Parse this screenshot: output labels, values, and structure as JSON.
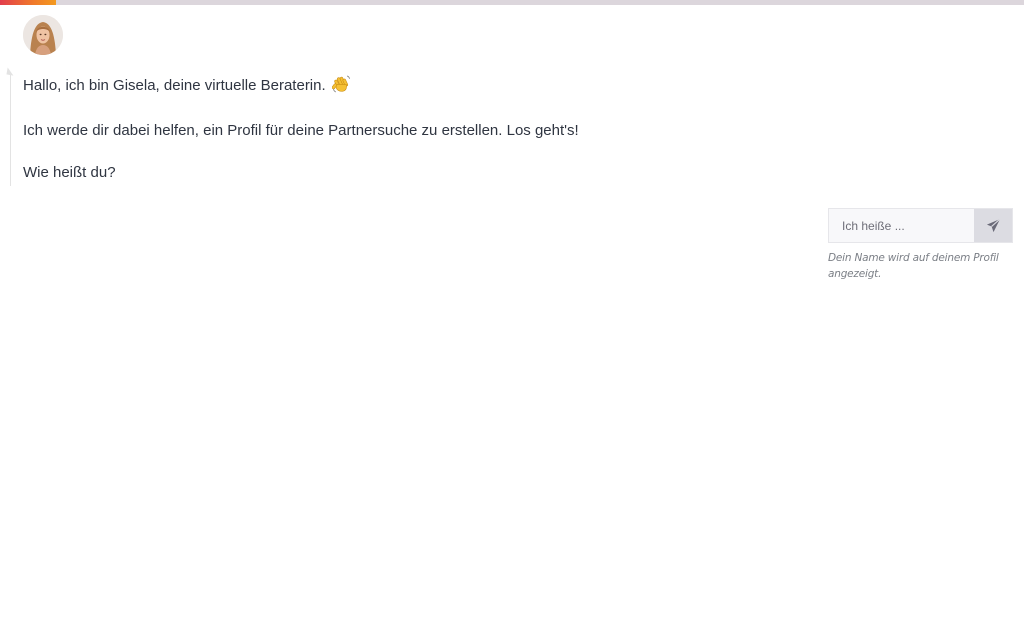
{
  "progress": {
    "value_percent": 5.5,
    "colors": {
      "track": "#dcd6dc",
      "fill_start": "#e23d4c",
      "fill_end": "#f39a1f"
    }
  },
  "advisor": {
    "avatar_icon": "advisor-portrait-icon"
  },
  "messages": [
    {
      "text": "Hallo, ich bin Gisela, deine virtuelle Beraterin.",
      "emoji": "waving-hand-icon"
    },
    {
      "text": "Ich werde dir dabei helfen, ein Profil für deine Partnersuche zu erstellen. Los geht's!"
    },
    {
      "text": "Wie heißt du?"
    }
  ],
  "answer": {
    "value": "",
    "placeholder": "Ich heiße ...",
    "send_icon": "paper-plane-icon",
    "hint": "Dein Name wird auf deinem Profil angezeigt."
  }
}
